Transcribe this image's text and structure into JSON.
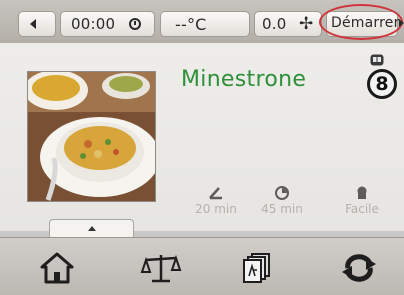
{
  "status_bar": {
    "time": "00:00",
    "temperature": "--°C",
    "speed": "0.0",
    "start_label": "Démarrer"
  },
  "recipe": {
    "title": "Minestrone",
    "step_number": "8",
    "prep_time": "20 min",
    "cook_time": "45 min",
    "difficulty": "Facile"
  },
  "icons": {
    "left_arrow": "triangle-left-icon",
    "clock": "clock-icon",
    "fan": "fan-icon",
    "book": "book-icon",
    "knife": "knife-icon",
    "cook": "clock-dial-icon",
    "chef": "chef-hat-icon",
    "home": "home-icon",
    "scale": "scale-icon",
    "pages": "pages-icon",
    "sync": "sync-icon"
  },
  "colors": {
    "title": "#2f8f3a",
    "start_ring": "#d0343a"
  }
}
